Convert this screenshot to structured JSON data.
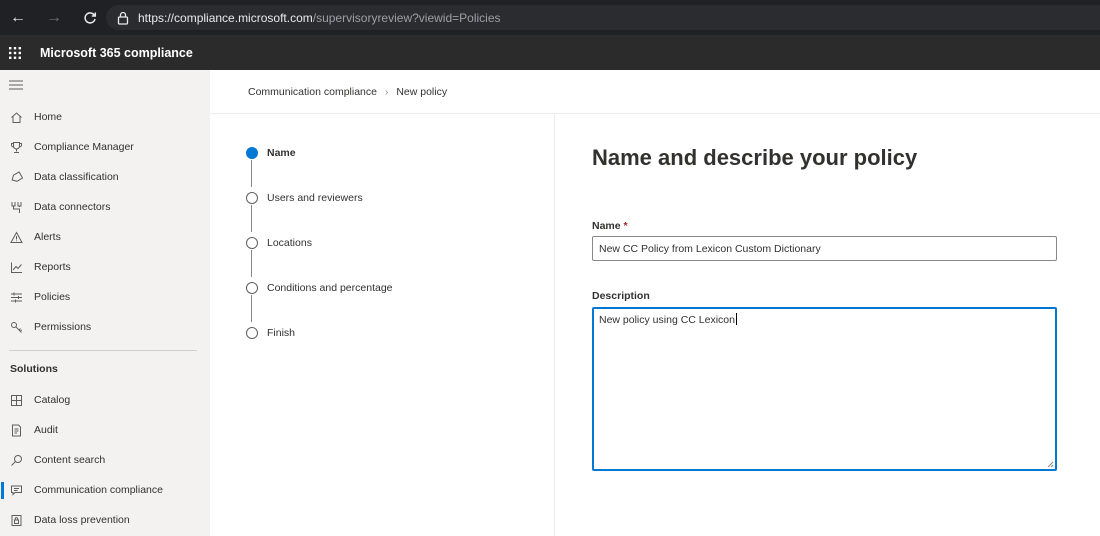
{
  "browser": {
    "url_scheme": "https://",
    "url_host": "compliance.microsoft.com",
    "url_path": "/supervisoryreview?viewid=Policies"
  },
  "app": {
    "title": "Microsoft 365 compliance"
  },
  "sidebar": {
    "items": [
      {
        "label": "Home",
        "icon": "home-icon"
      },
      {
        "label": "Compliance Manager",
        "icon": "trophy-icon"
      },
      {
        "label": "Data classification",
        "icon": "tag-icon"
      },
      {
        "label": "Data connectors",
        "icon": "connector-icon"
      },
      {
        "label": "Alerts",
        "icon": "alert-icon"
      },
      {
        "label": "Reports",
        "icon": "reports-icon"
      },
      {
        "label": "Policies",
        "icon": "policies-icon"
      },
      {
        "label": "Permissions",
        "icon": "permissions-icon"
      }
    ],
    "solutions_header": "Solutions",
    "solutions": [
      {
        "label": "Catalog",
        "icon": "catalog-icon"
      },
      {
        "label": "Audit",
        "icon": "audit-icon"
      },
      {
        "label": "Content search",
        "icon": "search-icon"
      },
      {
        "label": "Communication compliance",
        "icon": "communication-icon",
        "active": true
      },
      {
        "label": "Data loss prevention",
        "icon": "dlp-icon"
      }
    ]
  },
  "breadcrumb": {
    "parent": "Communication compliance",
    "current": "New policy"
  },
  "steps": [
    {
      "label": "Name",
      "current": true
    },
    {
      "label": "Users and reviewers"
    },
    {
      "label": "Locations"
    },
    {
      "label": "Conditions and percentage"
    },
    {
      "label": "Finish"
    }
  ],
  "form": {
    "heading": "Name and describe your policy",
    "name_label": "Name",
    "required_mark": "*",
    "name_value": "New CC Policy from Lexicon Custom Dictionary",
    "description_label": "Description",
    "description_value": "New policy using CC Lexicon"
  },
  "colors": {
    "accent": "#0078d4",
    "sidebar_bg": "#f3f2f1",
    "header_bg": "#2b2b2b"
  }
}
